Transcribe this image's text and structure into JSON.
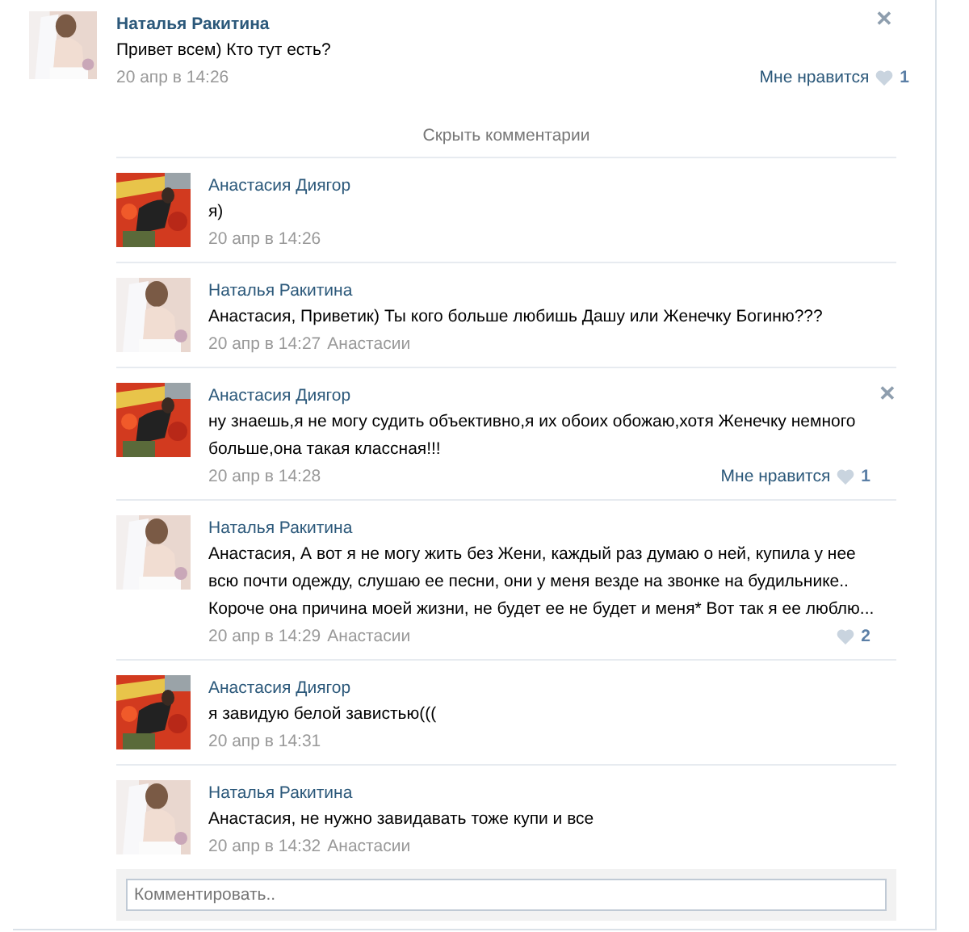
{
  "post": {
    "author": "Наталья Ракитина",
    "text": "Привет всем) Кто тут есть?",
    "date": "20 апр в 14:26",
    "like_label": "Мне нравится",
    "like_count": "1",
    "close": "✕"
  },
  "toggle_comments": "Скрыть комментарии",
  "comments": [
    {
      "author": "Анастасия Диягор",
      "text": "я)",
      "date": "20 апр в 14:26"
    },
    {
      "author": "Наталья Ракитина",
      "text": "Анастасия, Приветик) Ты кого больше любишь Дашу или Женечку Богиню???",
      "date": "20 апр в 14:27",
      "reply_to": "Анастасии"
    },
    {
      "author": "Анастасия Диягор",
      "text": "ну знаешь,я не могу судить объективно,я их обоих обожаю,хотя Женечку немного больше,она такая классная!!!",
      "date": "20 апр в 14:28",
      "like_label": "Мне нравится",
      "like_count": "1",
      "close": "✕"
    },
    {
      "author": "Наталья Ракитина",
      "text": "Анастасия, А вот я не могу жить без Жени, каждый раз думаю о ней, купила у нее всю почти одежду, слушаю ее песни, они у меня везде на звонке на будильнике.. Короче она причина моей жизни, не будет ее не будет и меня* Вот так я ее люблю...",
      "date": "20 апр в 14:29",
      "reply_to": "Анастасии",
      "like_count": "2"
    },
    {
      "author": "Анастасия Диягор",
      "text": "я завидую белой завистью(((",
      "date": "20 апр в 14:31"
    },
    {
      "author": "Наталья Ракитина",
      "text": "Анастасия, не нужно завидавать тоже купи и все",
      "date": "20 апр в 14:32",
      "reply_to": "Анастасии"
    }
  ],
  "comment_field": {
    "placeholder": "Комментировать.."
  }
}
